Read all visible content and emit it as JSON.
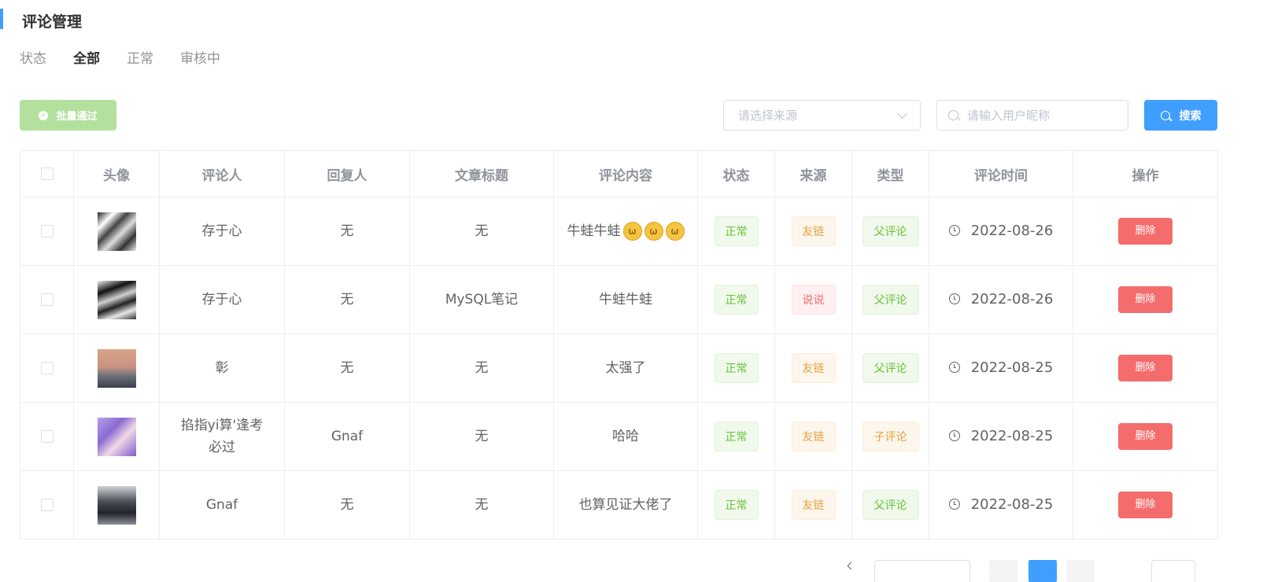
{
  "page": {
    "title": "评论管理"
  },
  "status_filter": {
    "label": "状态",
    "options": [
      "全部",
      "正常",
      "审核中"
    ],
    "active": "全部"
  },
  "toolbar": {
    "batch_approve_label": "批量通过",
    "source_placeholder": "请选择来源",
    "nickname_placeholder": "请输入用户昵称",
    "search_label": "搜索"
  },
  "table": {
    "columns": [
      "头像",
      "评论人",
      "回复人",
      "文章标题",
      "评论内容",
      "状态",
      "来源",
      "类型",
      "评论时间",
      "操作"
    ],
    "rows": [
      {
        "commenter": "存于心",
        "replier": "无",
        "article": "无",
        "content": "牛蛙牛蛙",
        "status": "正常",
        "source": "友链",
        "type": "父评论",
        "time": "2022-08-26",
        "action": "删除"
      },
      {
        "commenter": "存于心",
        "replier": "无",
        "article": "MySQL笔记",
        "content": "牛蛙牛蛙",
        "status": "正常",
        "source": "说说",
        "type": "父评论",
        "time": "2022-08-26",
        "action": "删除"
      },
      {
        "commenter": "彰",
        "replier": "无",
        "article": "无",
        "content": "太强了",
        "status": "正常",
        "source": "友链",
        "type": "父评论",
        "time": "2022-08-25",
        "action": "删除"
      },
      {
        "commenter": "掐指yi算'逢考必过",
        "replier": "Gnaf",
        "article": "无",
        "content": "哈哈",
        "status": "正常",
        "source": "友链",
        "type": "子评论",
        "time": "2022-08-25",
        "action": "删除"
      },
      {
        "commenter": "Gnaf",
        "replier": "无",
        "article": "无",
        "content": "也算见证大佬了",
        "status": "正常",
        "source": "友链",
        "type": "父评论",
        "time": "2022-08-25",
        "action": "删除"
      }
    ]
  },
  "icons": {
    "batch": "check-circle-icon",
    "select": "chevron-down-icon",
    "search": "search-icon",
    "time": "clock-icon",
    "emoji": "cat-emoji-icon"
  },
  "colors": {
    "primary": "#409eff",
    "success": "#67c23a",
    "warning": "#e6a23c",
    "danger": "#f56c6c",
    "batch_disabled": "#b3e19d"
  }
}
